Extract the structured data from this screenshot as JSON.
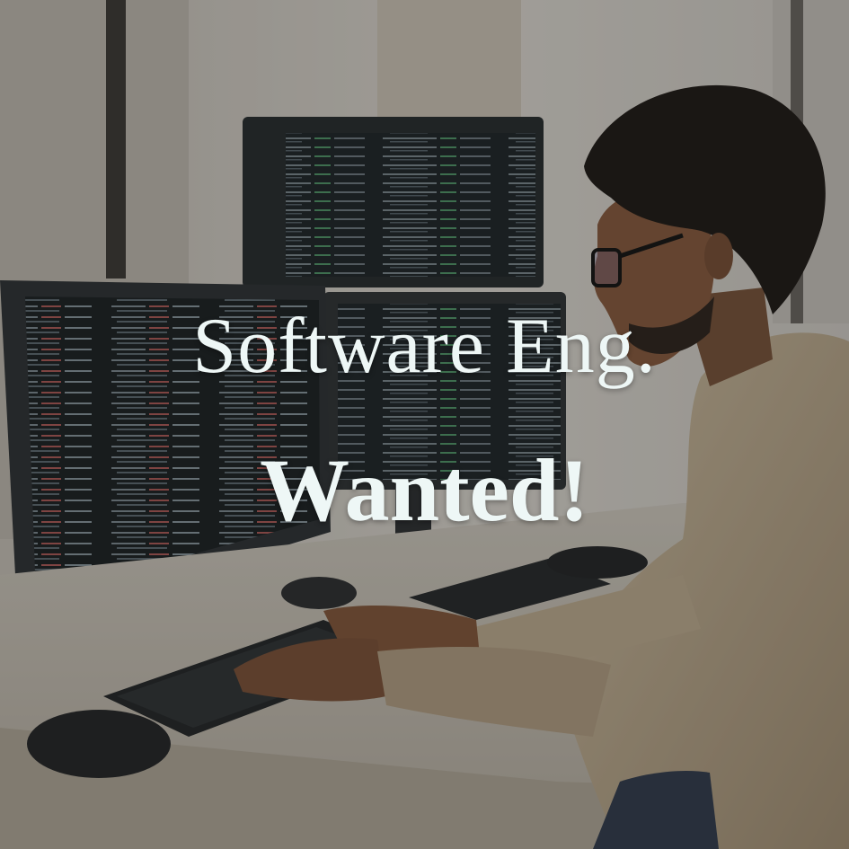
{
  "headline": {
    "line1": "Software Eng.",
    "line2": "Wanted!"
  },
  "colors": {
    "text": "#eef7f6",
    "wall": "#d9d4cc",
    "desk": "#cfc8bd",
    "screen": "#1c2226",
    "shirt": "#c9b79c"
  }
}
